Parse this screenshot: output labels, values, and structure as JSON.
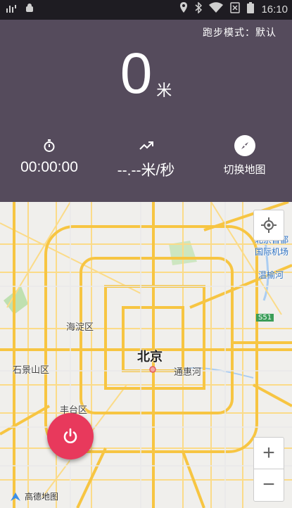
{
  "status_bar": {
    "time": "16:10",
    "icons": [
      "signal-icon",
      "android-icon",
      "location-icon",
      "bluetooth-icon",
      "wifi-icon",
      "no-sim-icon",
      "battery-icon"
    ]
  },
  "header": {
    "mode_label": "跑步模式：默认",
    "distance": "0",
    "distance_unit": "米",
    "duration": "00:00:00",
    "speed": "--.--米/秒",
    "switch_map_label": "切换地图"
  },
  "map": {
    "labels": {
      "city": "北京",
      "haidian": "海淀区",
      "shijingshan": "石景山区",
      "fengtai": "丰台区",
      "tonghuihe": "通惠河",
      "airport": "北京首都国际机场",
      "airport_line1": "北京首都",
      "airport_line2": "国际机场",
      "wenyu": "温榆河",
      "road": "S51"
    },
    "logo": "高德地图",
    "zoom_in": "+",
    "zoom_out": "−"
  },
  "colors": {
    "header_bg": "#554b5c",
    "power_button": "#e8395c",
    "road_major": "#f7c542",
    "road_minor": "#fbdb88"
  }
}
